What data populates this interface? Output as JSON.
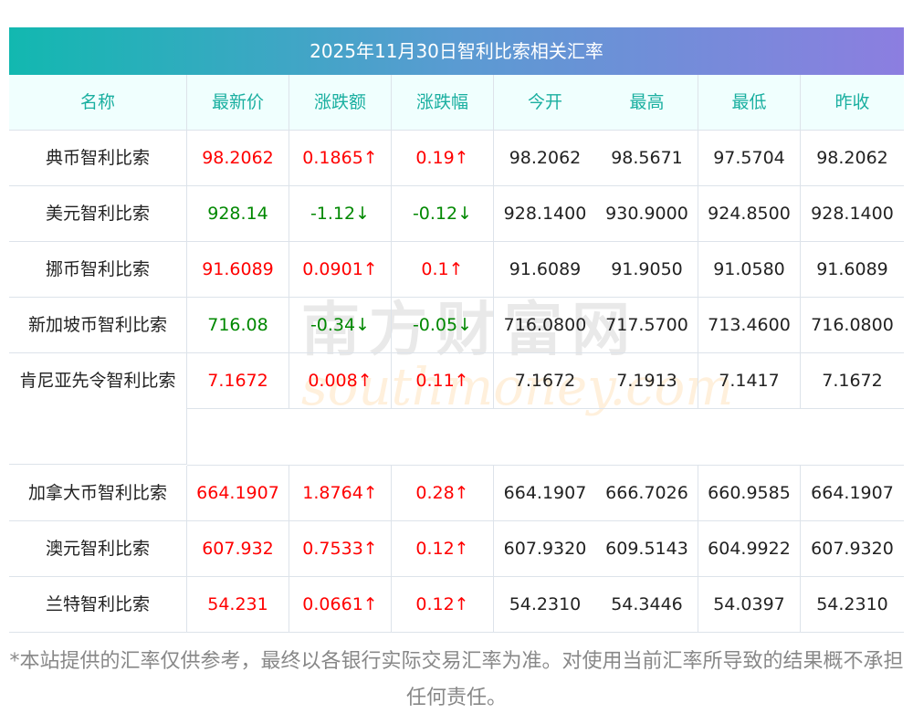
{
  "title": "2025年11月30日智利比索相关汇率",
  "headers": [
    "名称",
    "最新价",
    "涨跌额",
    "涨跌幅",
    "今开",
    "最高",
    "最低",
    "昨收"
  ],
  "rows": [
    {
      "name": "典币智利比索",
      "price": "98.2062",
      "change": "0.1865↑",
      "pct": "0.19↑",
      "open": "98.2062",
      "high": "98.5671",
      "low": "97.5704",
      "prev": "98.2062",
      "dir": "up"
    },
    {
      "name": "美元智利比索",
      "price": "928.14",
      "change": "-1.12↓",
      "pct": "-0.12↓",
      "open": "928.1400",
      "high": "930.9000",
      "low": "924.8500",
      "prev": "928.1400",
      "dir": "down"
    },
    {
      "name": "挪币智利比索",
      "price": "91.6089",
      "change": "0.0901↑",
      "pct": "0.1↑",
      "open": "91.6089",
      "high": "91.9050",
      "low": "91.0580",
      "prev": "91.6089",
      "dir": "up"
    },
    {
      "name": "新加坡币智利比索",
      "price": "716.08",
      "change": "-0.34↓",
      "pct": "-0.05↓",
      "open": "716.0800",
      "high": "717.5700",
      "low": "713.4600",
      "prev": "716.0800",
      "dir": "down"
    },
    {
      "name": "肯尼亚先令智利比索",
      "price": "7.1672",
      "change": "0.008↑",
      "pct": "0.11↑",
      "open": "7.1672",
      "high": "7.1913",
      "low": "7.1417",
      "prev": "7.1672",
      "dir": "up"
    },
    {
      "name": "加拿大币智利比索",
      "price": "664.1907",
      "change": "1.8764↑",
      "pct": "0.28↑",
      "open": "664.1907",
      "high": "666.7026",
      "low": "660.9585",
      "prev": "664.1907",
      "dir": "up"
    },
    {
      "name": "澳元智利比索",
      "price": "607.932",
      "change": "0.7533↑",
      "pct": "0.12↑",
      "open": "607.9320",
      "high": "609.5143",
      "low": "604.9922",
      "prev": "607.9320",
      "dir": "up"
    },
    {
      "name": "兰特智利比索",
      "price": "54.231",
      "change": "0.0661↑",
      "pct": "0.12↑",
      "open": "54.2310",
      "high": "54.3446",
      "low": "54.0397",
      "prev": "54.2310",
      "dir": "up"
    }
  ],
  "watermark": {
    "cn": "南方财富网",
    "en": "southmoney.com"
  },
  "footer": "*本站提供的汇率仅供参考，最终以各银行实际交易汇率为准。对使用当前汇率所导致的结果概不承担任何责任。",
  "colors": {
    "up": "#ff0000",
    "down": "#008000",
    "header_text": "#1aafa0"
  }
}
